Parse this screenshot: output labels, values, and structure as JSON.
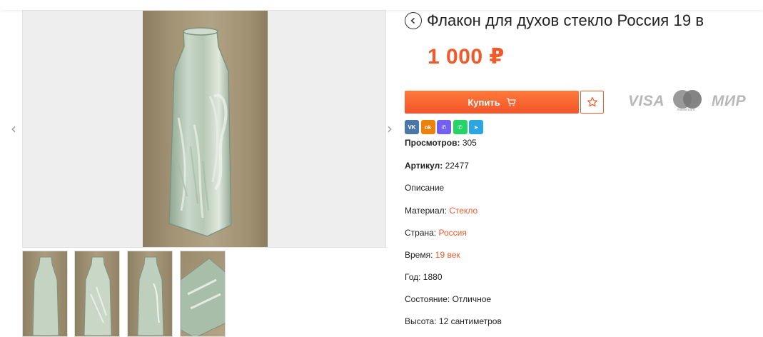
{
  "product": {
    "title": "Флакон для духов стекло Россия 19 в",
    "price": "1 000 ₽"
  },
  "buy": {
    "label": "Купить"
  },
  "payment": {
    "visa": "VISA",
    "mastercard": "mastercard",
    "mir": "МИР"
  },
  "share": [
    {
      "name": "vk",
      "glyph": "VK",
      "color": "#4a76a8"
    },
    {
      "name": "ok",
      "glyph": "ok",
      "color": "#ee8208"
    },
    {
      "name": "viber",
      "glyph": "✆",
      "color": "#7360f2"
    },
    {
      "name": "whatsapp",
      "glyph": "✆",
      "color": "#25d366"
    },
    {
      "name": "telegram",
      "glyph": "➤",
      "color": "#2ca5e0"
    }
  ],
  "stats": {
    "views_label": "Просмотров:",
    "views_value": "305",
    "sku_label": "Артикул:",
    "sku_value": "22477"
  },
  "description": {
    "heading": "Описание",
    "material_label": "Материал:",
    "material_value": "Стекло",
    "country_label": "Страна:",
    "country_value": "Россия",
    "time_label": "Время:",
    "time_value": "19 век",
    "year_label": "Год:",
    "year_value": "1880",
    "condition_label": "Состояние:",
    "condition_value": "Отличное",
    "height_label": "Высота:",
    "height_value": "12 сантиметров"
  },
  "colors": {
    "accent": "#f05a2b",
    "text": "#222222",
    "muted": "#9a9a9a"
  }
}
